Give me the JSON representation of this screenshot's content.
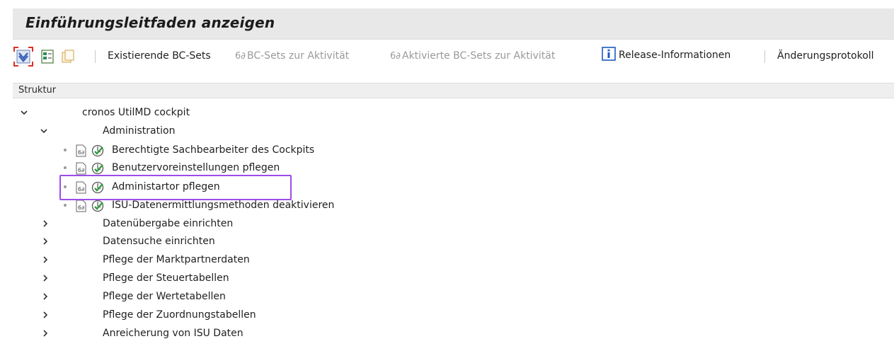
{
  "window": {
    "title": "Einführungsleitfaden anzeigen"
  },
  "toolbar": {
    "icons": [
      "expand-select-icon",
      "execute-icon",
      "copy-icon"
    ],
    "buttons": [
      {
        "label": "Existierende BC-Sets",
        "enabled": true
      },
      {
        "label": "BC-Sets zur Aktivität",
        "enabled": false
      },
      {
        "label": "Aktivierte BC-Sets zur Aktivität",
        "enabled": false
      },
      {
        "label": "Release-Informationen",
        "enabled": true
      },
      {
        "label": "Änderungsprotokoll",
        "enabled": true
      }
    ],
    "link_glyph": "6∂"
  },
  "structure": {
    "header": "Struktur",
    "root": {
      "label": "cronos UtilMD cockpit",
      "expanded": true
    },
    "group": {
      "label": "Administration",
      "expanded": true
    },
    "activities": [
      "Berechtigte Sachbearbeiter des Cockpits",
      "Benutzervoreinstellungen pflegen",
      "Administartor pflegen",
      "ISU-Datenermittlungsmethoden deaktivieren"
    ],
    "collapsed_nodes": [
      "Datenübergabe einrichten",
      "Datensuche einrichten",
      "Pflege der Marktpartnerdaten",
      "Pflege der Steuertabellen",
      "Pflege der Wertetabellen",
      "Pflege der Zuordnungstabellen",
      "Anreicherung von ISU Daten"
    ]
  },
  "colors": {
    "highlight": "#9b4dea",
    "info": "#1a5bbf"
  }
}
